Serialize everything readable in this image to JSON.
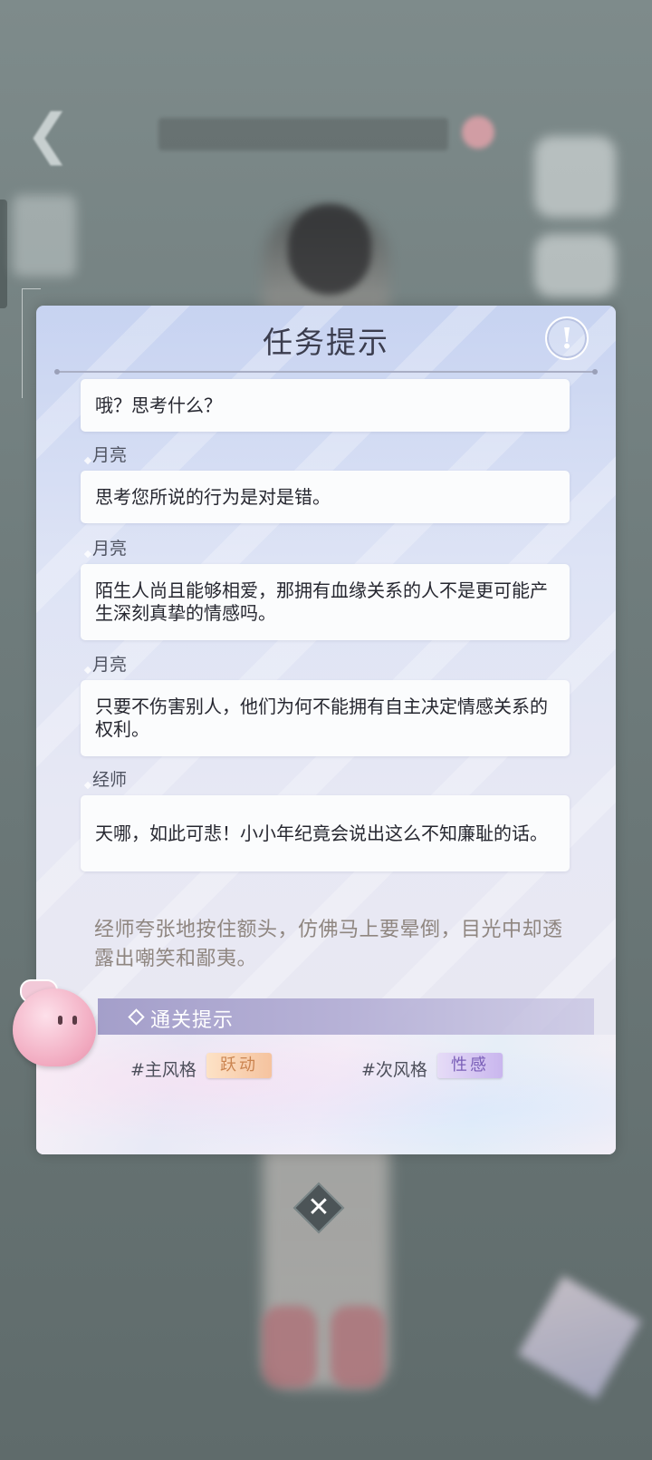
{
  "dialog": {
    "title": "任务提示",
    "info_icon": "exclamation-icon",
    "messages": [
      {
        "speaker": "",
        "text": "哦？思考什么？"
      },
      {
        "speaker": "月亮",
        "text": "思考您所说的行为是对是错。"
      },
      {
        "speaker": "月亮",
        "text": "陌生人尚且能够相爱，那拥有血缘关系的人不是更可能产生深刻真挚的情感吗。"
      },
      {
        "speaker": "月亮",
        "text": "只要不伤害别人，他们为何不能拥有自主决定情感关系的权利。"
      },
      {
        "speaker": "经师",
        "text": "天哪，如此可悲！小小年纪竟会说出这么不知廉耻的话。"
      }
    ],
    "narration": "经师夸张地按住额头，仿佛马上要晕倒，目光中却透露出嘲笑和鄙夷。",
    "hint": {
      "title": "通关提示",
      "main_style_label": "#主风格",
      "main_style_value": "跃动",
      "sub_style_label": "#次风格",
      "sub_style_value": "性感"
    },
    "close_icon": "close-icon"
  },
  "colors": {
    "panel_top": "#c7d3f1",
    "panel_bottom": "#e9e8f1",
    "hint_bar": "#a49fca",
    "main_badge": "#f5c39f",
    "sub_badge": "#c9b6ee"
  }
}
